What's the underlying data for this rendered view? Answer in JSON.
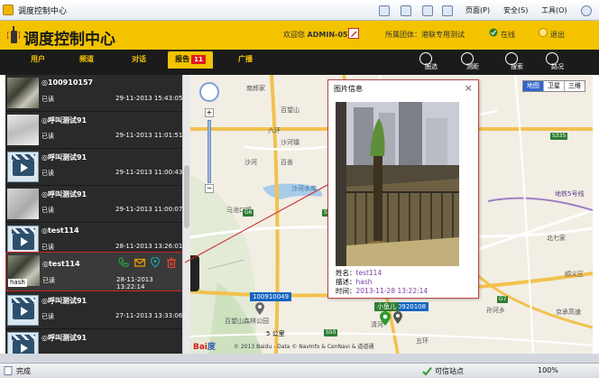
{
  "browser": {
    "page_title": "调度控制中心",
    "toolbar": {
      "page_menu": "页面(P)",
      "safety_menu": "安全(S)",
      "tools_menu": "工具(O)"
    }
  },
  "header": {
    "app_title": "调度控制中心",
    "welcome_prefix": "欢迎您",
    "username": "ADMIN-05",
    "group_prefix": "所属团体：",
    "group_name": "港联专用测试",
    "online_label": "在线",
    "logout_label": "退出"
  },
  "nav": {
    "tabs": [
      {
        "label": "用户"
      },
      {
        "label": "频道"
      },
      {
        "label": "对话"
      },
      {
        "label": "报告",
        "badge": "11"
      },
      {
        "label": "广播"
      }
    ],
    "tools": [
      {
        "label": "圈选"
      },
      {
        "label": "测距"
      },
      {
        "label": "搜索"
      },
      {
        "label": "路况"
      }
    ]
  },
  "reports": [
    {
      "sender": "100910157",
      "status": "已读",
      "time": "29-11-2013 15:43:05",
      "thumb": "photo-a"
    },
    {
      "sender": "呼叫测试91",
      "status": "已读",
      "time": "29-11-2013 11:01:51",
      "thumb": "photo-b"
    },
    {
      "sender": "呼叫测试91",
      "status": "已读",
      "time": "29-11-2013 11:00:43",
      "thumb": "video"
    },
    {
      "sender": "呼叫测试91",
      "status": "已读",
      "time": "29-11-2013 11:00:07",
      "thumb": "photo-c"
    },
    {
      "sender": "test114",
      "status": "已读",
      "time": "28-11-2013 13:26:01",
      "thumb": "video"
    },
    {
      "sender": "test114",
      "status": "已读",
      "time": "28-11-2013 13:22:14",
      "thumb": "photo-a",
      "caption": "hash",
      "selected": true
    },
    {
      "sender": "呼叫测试91",
      "status": "已读",
      "time": "27-11-2013 13:33:06",
      "thumb": "video"
    },
    {
      "sender": "呼叫测试91",
      "status": "",
      "time": "",
      "thumb": "video"
    }
  ],
  "map": {
    "types": [
      "地图",
      "卫星",
      "三维"
    ],
    "labels": [
      "南郎家",
      "百望山",
      "六环",
      "百望山森林公园",
      "沙河水库",
      "沙河镇",
      "马池口镇",
      "沙河",
      "百善",
      "地铁5号线",
      "S335",
      "G6",
      "S327",
      "G7",
      "S50",
      "北七家",
      "孙河乡",
      "顺义区",
      "京承高速",
      "清河",
      "五环"
    ],
    "markers": [
      {
        "id": "100910049",
        "color": "blue"
      },
      {
        "id": "100920108",
        "color": "blue"
      },
      {
        "id": "小鱼儿",
        "color": "green"
      }
    ],
    "scale_label": "5 公里",
    "copyright": "© 2013 Baidu - Data © NavInfo & CenNavi & 道道通"
  },
  "popup": {
    "title": "图片信息",
    "name_label": "姓名：",
    "name_value": "test114",
    "desc_label": "描述：",
    "desc_value": "hash",
    "time_label": "时间：",
    "time_value": "2013-11-28 13:22:14"
  },
  "statusbar": {
    "done": "完成",
    "trusted": "可信站点",
    "zoom": "100%"
  }
}
